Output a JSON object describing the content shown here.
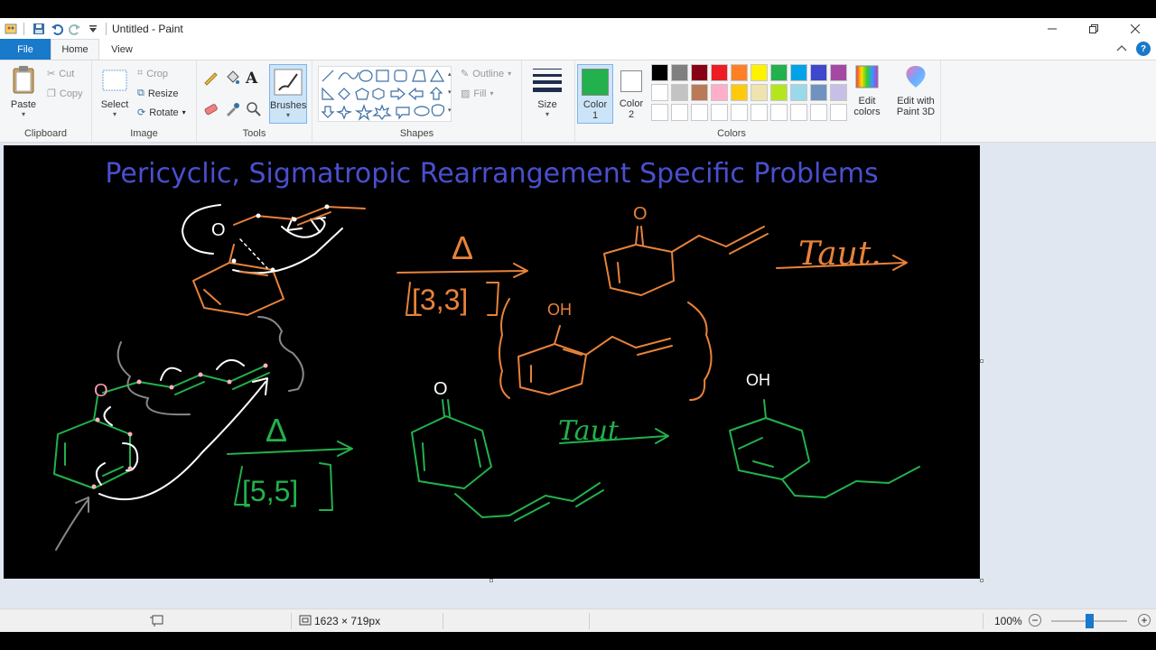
{
  "window": {
    "title": "Untitled - Paint"
  },
  "tabs": {
    "file": "File",
    "home": "Home",
    "view": "View"
  },
  "clipboard": {
    "paste": "Paste",
    "cut": "Cut",
    "copy": "Copy",
    "group": "Clipboard"
  },
  "image": {
    "select": "Select",
    "crop": "Crop",
    "resize": "Resize",
    "rotate": "Rotate",
    "group": "Image"
  },
  "tools": {
    "group": "Tools",
    "brushes": "Brushes"
  },
  "shapes": {
    "outline": "Outline",
    "fill": "Fill",
    "group": "Shapes"
  },
  "size": {
    "label": "Size"
  },
  "colors": {
    "color1_label": "Color",
    "color1_num": "1",
    "color2_label": "Color",
    "color2_num": "2",
    "edit_colors_1": "Edit",
    "edit_colors_2": "colors",
    "paint3d_1": "Edit with",
    "paint3d_2": "Paint 3D",
    "group": "Colors",
    "color1": "#22b14c",
    "color2": "#ffffff",
    "palette": [
      "#000000",
      "#7f7f7f",
      "#880015",
      "#ed1c24",
      "#ff7f27",
      "#fff200",
      "#22b14c",
      "#00a2e8",
      "#3f48cc",
      "#a349a4",
      "#ffffff",
      "#c3c3c3",
      "#b97a57",
      "#ffaec9",
      "#ffc90e",
      "#efe4b0",
      "#b5e61d",
      "#99d9ea",
      "#7092be",
      "#c8bfe7",
      "#ffffff",
      "#ffffff",
      "#ffffff",
      "#ffffff",
      "#ffffff",
      "#ffffff",
      "#ffffff",
      "#ffffff",
      "#ffffff",
      "#ffffff"
    ]
  },
  "canvas": {
    "title": "Pericyclic, Sigmatropic Rearrangement Specific Problems",
    "labels": {
      "o_top": "O",
      "o_mid": "O",
      "oh_1": "OH",
      "o_left": "O",
      "oh_2": "OH",
      "taut_1": "Taut.",
      "taut_2": "Taut",
      "tri_1": "Δ",
      "tri_2": "Δ",
      "cond_1": "[3,3]",
      "cond_2": "[5,5]"
    }
  },
  "status": {
    "dimensions": "1623 × 719px",
    "zoom": "100%",
    "zoom_value": 100
  }
}
